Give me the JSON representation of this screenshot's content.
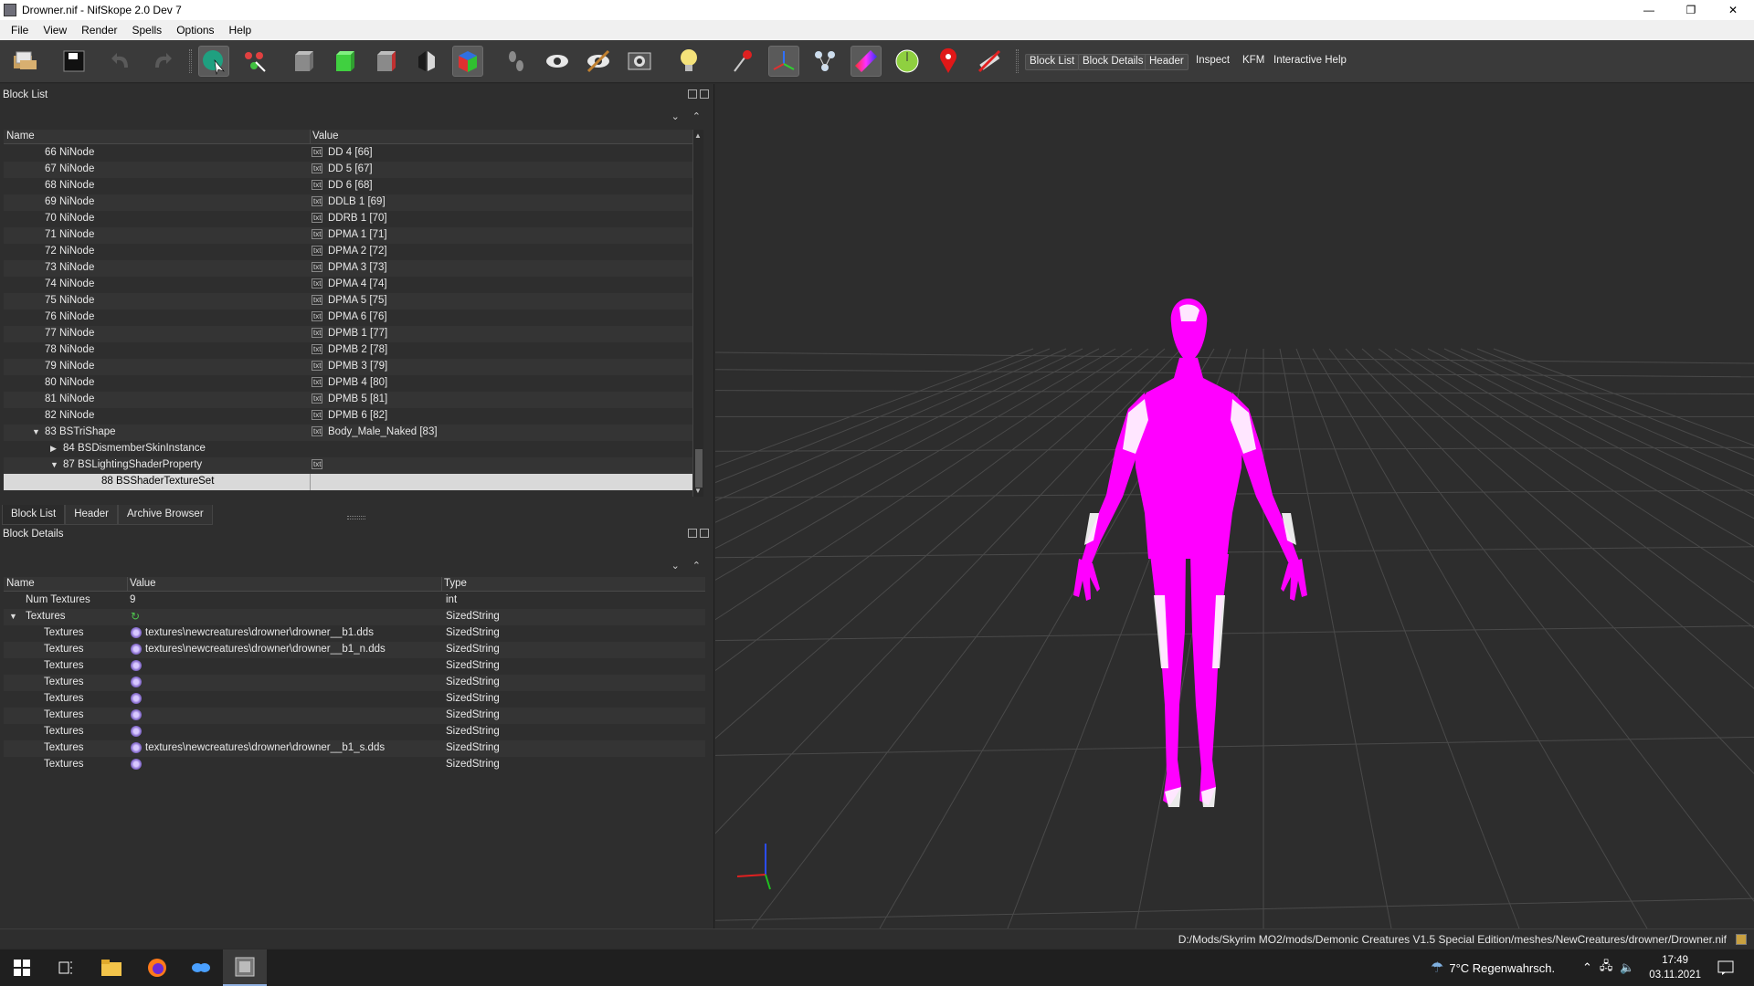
{
  "window": {
    "title": "Drowner.nif - NifSkope 2.0 Dev 7",
    "controls": {
      "minimize": "—",
      "maximize": "❐",
      "close": "✕"
    }
  },
  "menu": [
    "File",
    "View",
    "Render",
    "Spells",
    "Options",
    "Help"
  ],
  "toolbar": {
    "icons": [
      "open-icon",
      "save-icon",
      "undo-icon",
      "redo-icon",
      "select-icon",
      "connect-icon",
      "cube-grey-icon",
      "cube-green-icon",
      "cube-red-icon",
      "flip-icon",
      "cube-color-icon",
      "footsteps-icon",
      "eye-icon",
      "eye-strike-icon",
      "screenshot-icon",
      "lightbulb-icon",
      "pin-icon",
      "axes-icon",
      "nodes-icon",
      "gradient-icon",
      "radar-icon",
      "marker-icon",
      "no-draw-icon"
    ],
    "docks": [
      "Block List",
      "Block Details",
      "Header",
      "Inspect",
      "KFM",
      "Interactive Help"
    ]
  },
  "block_list": {
    "panel_title": "Block List",
    "col_name": "Name",
    "col_value": "Value",
    "rows": [
      {
        "name": "66 NiNode",
        "value": "DD 4 [66]"
      },
      {
        "name": "67 NiNode",
        "value": "DD 5 [67]"
      },
      {
        "name": "68 NiNode",
        "value": "DD 6 [68]"
      },
      {
        "name": "69 NiNode",
        "value": "DDLB 1 [69]"
      },
      {
        "name": "70 NiNode",
        "value": "DDRB 1 [70]"
      },
      {
        "name": "71 NiNode",
        "value": "DPMA 1 [71]"
      },
      {
        "name": "72 NiNode",
        "value": "DPMA 2 [72]"
      },
      {
        "name": "73 NiNode",
        "value": "DPMA 3 [73]"
      },
      {
        "name": "74 NiNode",
        "value": "DPMA 4 [74]"
      },
      {
        "name": "75 NiNode",
        "value": "DPMA 5 [75]"
      },
      {
        "name": "76 NiNode",
        "value": "DPMA 6 [76]"
      },
      {
        "name": "77 NiNode",
        "value": "DPMB 1 [77]"
      },
      {
        "name": "78 NiNode",
        "value": "DPMB 2 [78]"
      },
      {
        "name": "79 NiNode",
        "value": "DPMB 3 [79]"
      },
      {
        "name": "80 NiNode",
        "value": "DPMB 4 [80]"
      },
      {
        "name": "81 NiNode",
        "value": "DPMB 5 [81]"
      },
      {
        "name": "82 NiNode",
        "value": "DPMB 6 [82]"
      },
      {
        "name": "83 BSTriShape",
        "value": "Body_Male_Naked [83]"
      },
      {
        "name": "84 BSDismemberSkinInstance",
        "value": ""
      },
      {
        "name": "87 BSLightingShaderProperty",
        "value": ""
      },
      {
        "name": "88 BSShaderTextureSet",
        "value": ""
      }
    ],
    "tabs": [
      "Block List",
      "Header",
      "Archive Browser"
    ]
  },
  "block_details": {
    "panel_title": "Block Details",
    "col_name": "Name",
    "col_value": "Value",
    "col_type": "Type",
    "rows": [
      {
        "name": "Num Textures",
        "value": "9",
        "type": "int"
      },
      {
        "name": "Textures",
        "value": "",
        "type": "SizedString"
      },
      {
        "name": "Textures",
        "value": "textures\\newcreatures\\drowner\\drowner__b1.dds",
        "type": "SizedString"
      },
      {
        "name": "Textures",
        "value": "textures\\newcreatures\\drowner\\drowner__b1_n.dds",
        "type": "SizedString"
      },
      {
        "name": "Textures",
        "value": "",
        "type": "SizedString"
      },
      {
        "name": "Textures",
        "value": "",
        "type": "SizedString"
      },
      {
        "name": "Textures",
        "value": "",
        "type": "SizedString"
      },
      {
        "name": "Textures",
        "value": "",
        "type": "SizedString"
      },
      {
        "name": "Textures",
        "value": "",
        "type": "SizedString"
      },
      {
        "name": "Textures",
        "value": "textures\\newcreatures\\drowner\\drowner__b1_s.dds",
        "type": "SizedString"
      },
      {
        "name": "Textures",
        "value": "",
        "type": "SizedString"
      }
    ]
  },
  "viewport": {
    "model_color": "#ff00ff",
    "grid_color": "#4a4a4a",
    "background": "#2d2d2d"
  },
  "status": {
    "path": "D:/Mods/Skyrim MO2/mods/Demonic Creatures V1.5 Special Edition/meshes/NewCreatures/drowner/Drowner.nif"
  },
  "taskbar": {
    "icons": [
      "windows-start-icon",
      "task-view-icon",
      "file-explorer-icon",
      "firefox-icon",
      "mo2-icon",
      "nifskope-icon"
    ],
    "weather": "7°C  Regenwahrsch.",
    "time": "17:49",
    "date": "03.11.2021"
  },
  "text_tags": {
    "txt": "txt"
  }
}
